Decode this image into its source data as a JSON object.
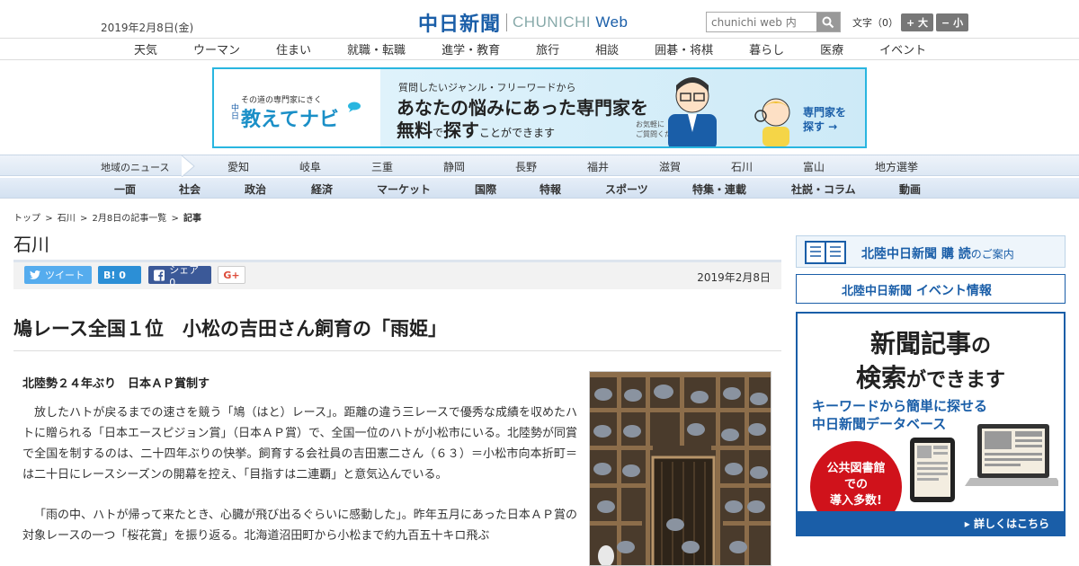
{
  "header": {
    "date": "2019年2月8日(金)",
    "logo_kanji": "中日新聞",
    "logo_roman": "CHUNICHI",
    "logo_web": "Web",
    "search_placeholder": "chunichi web 内",
    "font_label": "文字（0）",
    "font_up": "+ 大",
    "font_down": "− 小"
  },
  "topnav": [
    "天気",
    "ウーマン",
    "住まい",
    "就職・転職",
    "進学・教育",
    "旅行",
    "相談",
    "囲碁・将棋",
    "暮らし",
    "医療",
    "イベント"
  ],
  "banner": {
    "tagline": "その道の専門家にきく",
    "brand_prefix": "中日",
    "brand": "教えてナビ",
    "line1": "質問したいジャンル・フリーワードから",
    "line2": "あなたの悩みにあった専門家を",
    "line3_a": "無料",
    "line3_b": "で",
    "line3_c": "探す",
    "line3_d": "ことができます",
    "note": "お気軽に\nご質問ください!",
    "cta": "専門家を\n探す →"
  },
  "region_nav": {
    "label": "地域のニュース",
    "items": [
      "愛知",
      "岐阜",
      "三重",
      "静岡",
      "長野",
      "福井",
      "滋賀",
      "石川",
      "富山",
      "地方選挙"
    ]
  },
  "category_nav": [
    "一面",
    "社会",
    "政治",
    "経済",
    "マーケット",
    "国際",
    "特報",
    "スポーツ",
    "特集・連載",
    "社説・コラム",
    "動画"
  ],
  "breadcrumb": [
    "トップ",
    ">",
    "石川",
    ">",
    "2月8日の記事一覧",
    ">",
    "記事"
  ],
  "section_title": "石川",
  "share": {
    "tweet": "ツイート",
    "hatena": "B! 0",
    "facebook": "シェア 0",
    "gplus": "G+",
    "date": "2019年2月8日"
  },
  "article": {
    "headline": "鳩レース全国１位　小松の吉田さん飼育の「雨姫」",
    "subhead": "北陸勢２４年ぶり　日本ＡＰ賞制す",
    "paragraphs": [
      "放したハトが戻るまでの速さを競う「鳩（はと）レース」。距離の違う三レースで優秀な成績を収めたハトに贈られる「日本エースピジョン賞」（日本ＡＰ賞）で、全国一位のハトが小松市にいる。北陸勢が同賞で全国を制するのは、二十四年ぶりの快挙。飼育する会社員の吉田憲二さん（６３）＝小松市向本折町＝は二十日にレースシーズンの開幕を控え、「目指すは二連覇」と意気込んでいる。",
      "「雨の中、ハトが帰って来たとき、心臓が飛び出るぐらいに感動した」。昨年五月にあった日本ＡＰ賞の対象レースの一つ「桜花賞」を振り返る。北海道沼田町から小松まで約九百五十キロ飛ぶ"
    ]
  },
  "sidebar": {
    "ad1_brand": "北陸中日新聞",
    "ad1_text": "購 読",
    "ad1_suffix": "のご案内",
    "ad2_brand": "北陸中日新聞",
    "ad2_text": "イベント情報",
    "ad3_line1_a": "新聞記事",
    "ad3_line1_b": "の",
    "ad3_line2_a": "検索",
    "ad3_line2_b": "ができます",
    "ad3_line3": "キーワードから簡単に探せる",
    "ad3_line4": "中日新聞データベース",
    "ad3_badge": "公共図書館\nでの\n導入多数!",
    "ad3_cta": "▸ 詳しくはこちら"
  },
  "colors": {
    "brand_blue": "#1a5ea8",
    "banner_border": "#29b6e0",
    "twitter": "#55acee",
    "hatena": "#2c8fd6",
    "facebook": "#3b5998",
    "badge_red": "#d0121b"
  }
}
